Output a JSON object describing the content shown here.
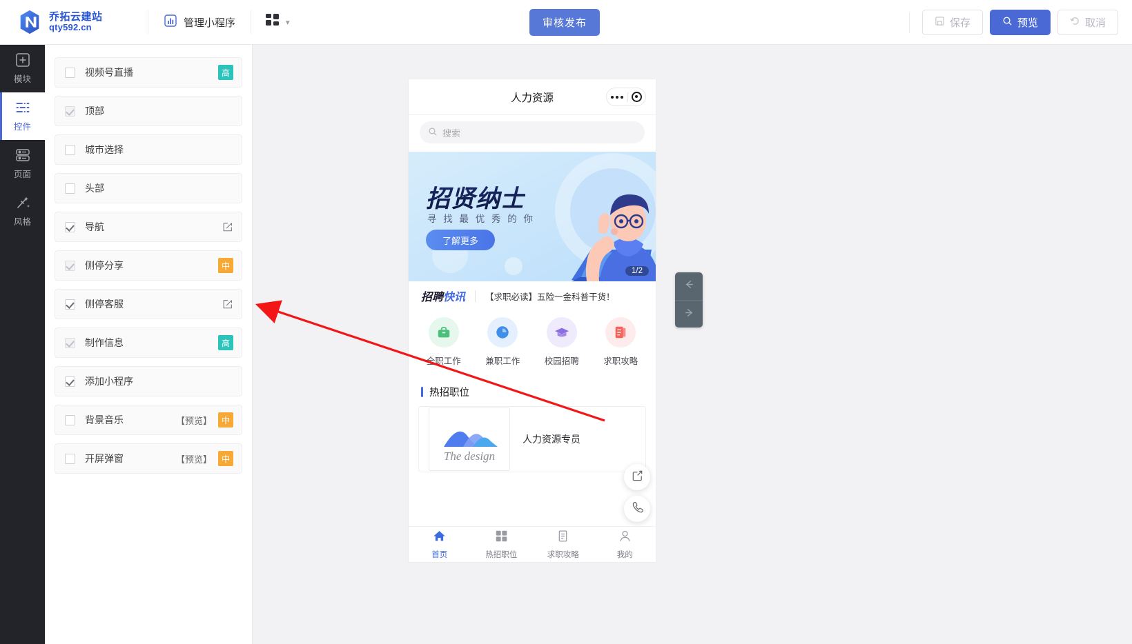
{
  "topbar": {
    "brand_name": "乔拓云建站",
    "brand_sub": "qty592.cn",
    "nav_manage": "管理小程序",
    "manage_icon": "chart-bar-icon",
    "grid_icon": "grid-apps-icon",
    "chevron_icon": "chevron-down-icon",
    "publish_label": "审核发布",
    "save_label": "保存",
    "save_icon": "save-floppy-icon",
    "preview_label": "预览",
    "preview_icon": "search-magnifier-icon",
    "cancel_label": "取消",
    "cancel_icon": "undo-arrow-icon"
  },
  "rail": {
    "items": [
      {
        "label": "模块",
        "icon": "plus-square-icon",
        "active": false
      },
      {
        "label": "控件",
        "icon": "sliders-controls-icon",
        "active": true
      },
      {
        "label": "页面",
        "icon": "pages-stack-icon",
        "active": false
      },
      {
        "label": "风格",
        "icon": "magic-wand-icon",
        "active": false
      }
    ]
  },
  "components": [
    {
      "label": "视频号直播",
      "state": "unchecked",
      "tag": "高",
      "tag_type": "high",
      "preview": "",
      "edit": false
    },
    {
      "label": "顶部",
      "state": "dim",
      "tag": "",
      "tag_type": "",
      "preview": "",
      "edit": false
    },
    {
      "label": "城市选择",
      "state": "unchecked",
      "tag": "",
      "tag_type": "",
      "preview": "",
      "edit": false
    },
    {
      "label": "头部",
      "state": "unchecked",
      "tag": "",
      "tag_type": "",
      "preview": "",
      "edit": false
    },
    {
      "label": "导航",
      "state": "checked",
      "tag": "",
      "tag_type": "",
      "preview": "",
      "edit": true
    },
    {
      "label": "侧停分享",
      "state": "dim",
      "tag": "中",
      "tag_type": "mid",
      "preview": "",
      "edit": false
    },
    {
      "label": "侧停客服",
      "state": "checked",
      "tag": "",
      "tag_type": "",
      "preview": "",
      "edit": true
    },
    {
      "label": "制作信息",
      "state": "dim",
      "tag": "高",
      "tag_type": "high",
      "preview": "",
      "edit": false
    },
    {
      "label": "添加小程序",
      "state": "checked",
      "tag": "",
      "tag_type": "",
      "preview": "",
      "edit": false
    },
    {
      "label": "背景音乐",
      "state": "unchecked",
      "tag": "中",
      "tag_type": "mid",
      "preview": "【预览】",
      "edit": false
    },
    {
      "label": "开屏弹窗",
      "state": "unchecked",
      "tag": "中",
      "tag_type": "mid",
      "preview": "【预览】",
      "edit": false
    }
  ],
  "preview": {
    "title": "人力资源",
    "capsule_more_icon": "more-dots-icon",
    "capsule_target_icon": "target-circle-icon",
    "search_placeholder": "搜索",
    "search_icon": "search-magnifier-icon",
    "banner": {
      "title": "招贤纳士",
      "subtitle": "寻 找 最 优 秀 的 你",
      "button": "了解更多",
      "counter": "1/2"
    },
    "news": {
      "tag_left": "招聘",
      "tag_right": "快讯",
      "text": "【求职必读】五险一金科普干货！"
    },
    "quick_entries": [
      {
        "label": "全职工作",
        "icon": "briefcase-icon",
        "color": "#4bc07a",
        "bg": "#e6f8ed"
      },
      {
        "label": "兼职工作",
        "icon": "clock-icon",
        "color": "#3f8ee8",
        "bg": "#e4f0fd"
      },
      {
        "label": "校园招聘",
        "icon": "graduation-cap-icon",
        "color": "#8b6fe0",
        "bg": "#f0eafd"
      },
      {
        "label": "求职攻略",
        "icon": "document-stack-icon",
        "color": "#f4645c",
        "bg": "#fdeceb"
      }
    ],
    "section_title": "热招职位",
    "job": {
      "image_caption": "The design",
      "name": "人力资源专员"
    },
    "float_buttons": [
      {
        "icon": "share-box-icon"
      },
      {
        "icon": "phone-call-icon"
      }
    ],
    "tabs": [
      {
        "label": "首页",
        "icon": "home-icon",
        "active": true
      },
      {
        "label": "热招职位",
        "icon": "grid-apps-icon",
        "active": false
      },
      {
        "label": "求职攻略",
        "icon": "document-icon",
        "active": false
      },
      {
        "label": "我的",
        "icon": "user-icon",
        "active": false
      }
    ]
  },
  "canvas_controls": {
    "prev_icon": "arrow-left-icon",
    "next_icon": "arrow-right-icon"
  },
  "colors": {
    "accent": "#4a69d4",
    "publish": "#5878d8",
    "tag_high": "#2bc4bb",
    "tag_mid": "#f6a935",
    "annotation": "#f21616",
    "rail_bg": "#23242a"
  }
}
